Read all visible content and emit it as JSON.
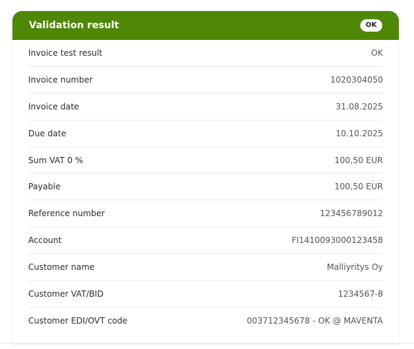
{
  "card": {
    "title": "Validation result",
    "status_badge": "OK",
    "header_color": "#4f8706"
  },
  "rows": [
    {
      "label": "Invoice test result",
      "value": "OK"
    },
    {
      "label": "Invoice number",
      "value": "1020304050"
    },
    {
      "label": "Invoice date",
      "value": "31.08.2025"
    },
    {
      "label": "Due date",
      "value": "10.10.2025"
    },
    {
      "label": "Sum VAT 0 %",
      "value": "100,50 EUR"
    },
    {
      "label": "Payable",
      "value": "100,50 EUR"
    },
    {
      "label": "Reference number",
      "value": "123456789012"
    },
    {
      "label": "Account",
      "value": "FI1410093000123458"
    },
    {
      "label": "Customer name",
      "value": "Malliyritys Oy"
    },
    {
      "label": "Customer VAT/BID",
      "value": "1234567-8"
    },
    {
      "label": "Customer EDI/OVT code",
      "value": "003712345678 - OK @ MAVENTA"
    }
  ]
}
